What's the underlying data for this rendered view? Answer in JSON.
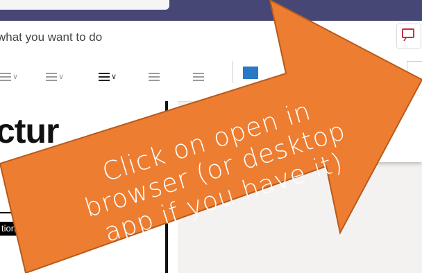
{
  "ribbon": {
    "tell_me": "what you want to do"
  },
  "document": {
    "heading_fragment": "ctur",
    "label_fragment": "tion"
  },
  "callout": {
    "line1": "Click on open in",
    "line2": "browser (or desktop",
    "line3": "app if you have it)",
    "color": "#ED7D31"
  },
  "icons": [
    "comment-icon",
    "bullets-icon",
    "numbering-icon",
    "align-icon",
    "decrease-indent-icon",
    "increase-indent-icon"
  ]
}
